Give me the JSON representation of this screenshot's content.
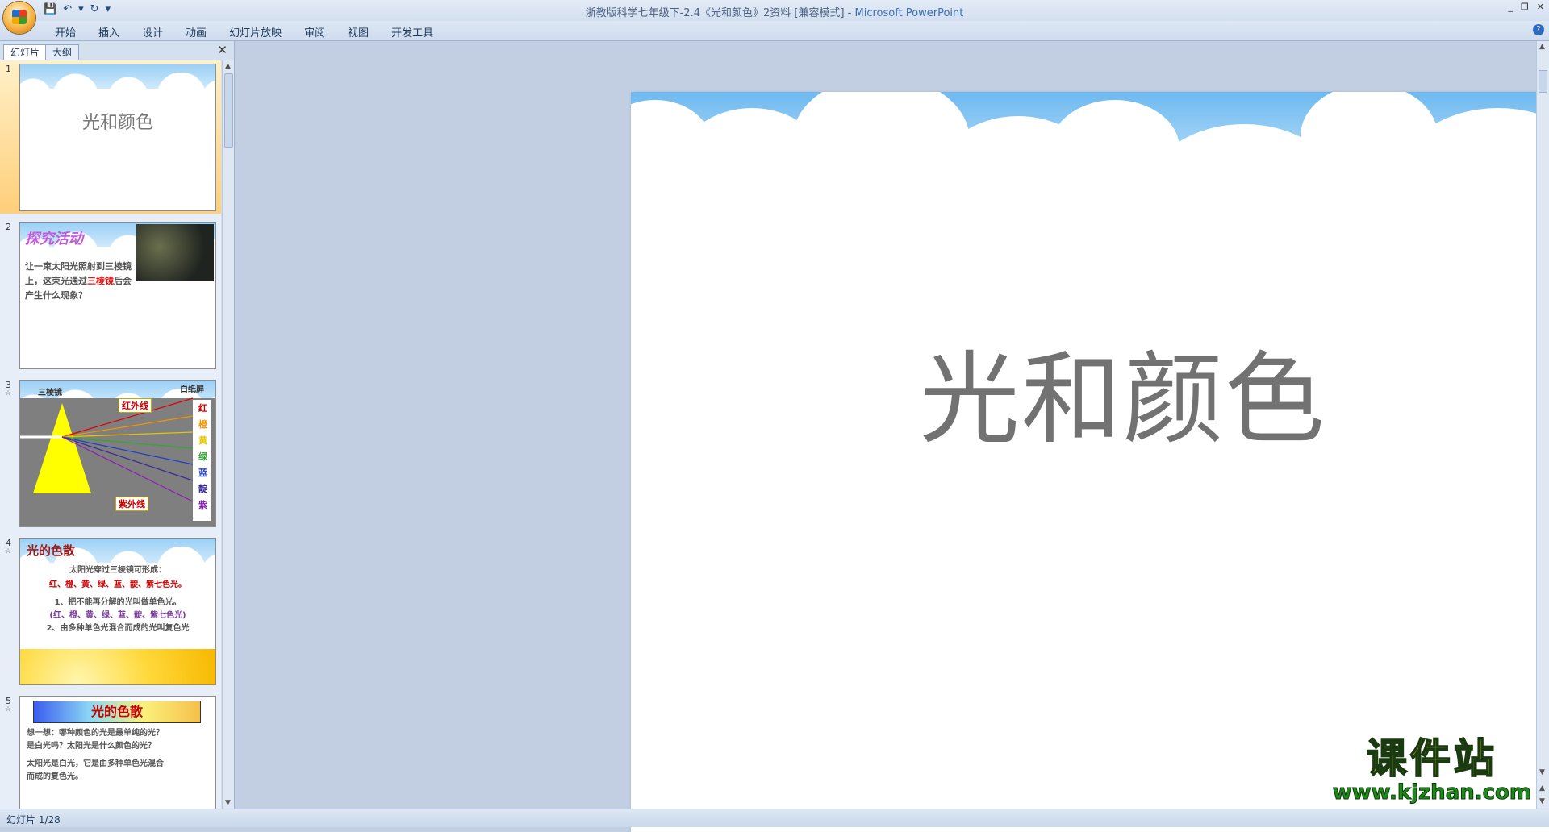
{
  "window": {
    "title": "浙教版科学七年级下-2.4《光和颜色》2资料 [兼容模式]",
    "separator": " - ",
    "app": "Microsoft PowerPoint",
    "controls": [
      "_",
      "❐",
      "✕"
    ]
  },
  "qat": {
    "save": "💾",
    "undo": "↶",
    "undo_drop": "▾",
    "redo": "↻",
    "customize": "▾"
  },
  "menu": [
    "开始",
    "插入",
    "设计",
    "动画",
    "幻灯片放映",
    "审阅",
    "视图",
    "开发工具"
  ],
  "help": "?",
  "left_pane": {
    "tabs": [
      "幻灯片",
      "大纲"
    ],
    "close": "✕"
  },
  "thumbs": {
    "s1": {
      "num": "1",
      "title": "光和颜色"
    },
    "s2": {
      "num": "2",
      "heading": "探究活动",
      "text_a": "让一束太阳光照射到三棱镜上，这束光通过",
      "text_red": "三棱镜",
      "text_b": "后会产生什么现象？"
    },
    "s3": {
      "num": "3",
      "prism": "三棱镜",
      "screen": "白纸屏",
      "infrared": "红外线",
      "ultraviolet": "紫外线",
      "colors": [
        "红",
        "橙",
        "黄",
        "绿",
        "蓝",
        "靛",
        "紫"
      ],
      "color_hex": [
        "#e00000",
        "#f39400",
        "#e2c800",
        "#2fa82f",
        "#1f3fc8",
        "#3a2a9a",
        "#8a1fb5"
      ]
    },
    "s4": {
      "num": "4",
      "heading": "光的色散",
      "line1": "太阳光穿过三棱镜可形成：",
      "line2": "红、橙、黄、绿、蓝、靛、紫七色光。",
      "line3": "1、把不能再分解的光叫做单色光。",
      "line4": "(红、橙、黄、绿、蓝、靛、紫七色光)",
      "line5": "2、由多种单色光混合而成的光叫复色光"
    },
    "s5": {
      "num": "5",
      "banner": "光的色散",
      "q1": "想一想：哪种颜色的光是最单纯的光？",
      "q2": "是白光吗？太阳光是什么颜色的光？",
      "a1": "太阳光是白光，它是由多种单色光混合",
      "a2": "而成的复色光。"
    }
  },
  "main_slide": {
    "title": "光和颜色"
  },
  "status": {
    "text": "幻灯片 1/28"
  },
  "watermark": {
    "cn": "课件站",
    "url": "www.kjzhan.com"
  }
}
